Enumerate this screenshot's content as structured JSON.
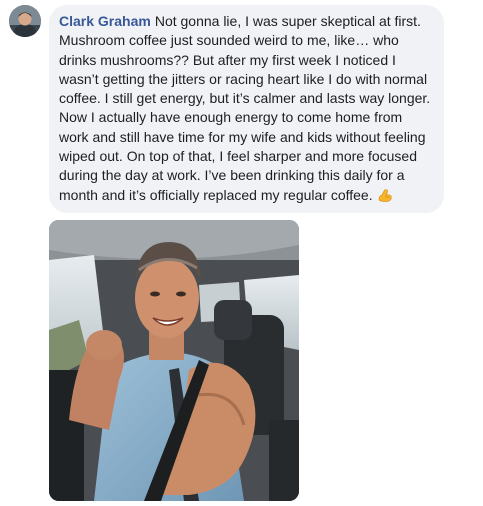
{
  "comment": {
    "author": "Clark Graham",
    "text": "Not gonna lie, I was super skeptical at first. Mushroom coffee just sounded weird to me, like… who drinks mushrooms?? But after my first week I noticed I wasn’t getting the jitters or racing heart like I do with normal coffee. I still get energy, but it’s calmer and lasts way longer. Now I actually have enough energy to come home from work and still have time for my wife and kids without feeling wiped out. On top of that, I feel sharper and more focused during the day at work. I’ve been drinking this daily for a month and it’s officially replaced my regular coffee.",
    "emoji": "flexed-biceps-icon"
  },
  "colors": {
    "bubble_bg": "#f0f2f5",
    "author": "#385898",
    "text": "#1c1e21"
  }
}
